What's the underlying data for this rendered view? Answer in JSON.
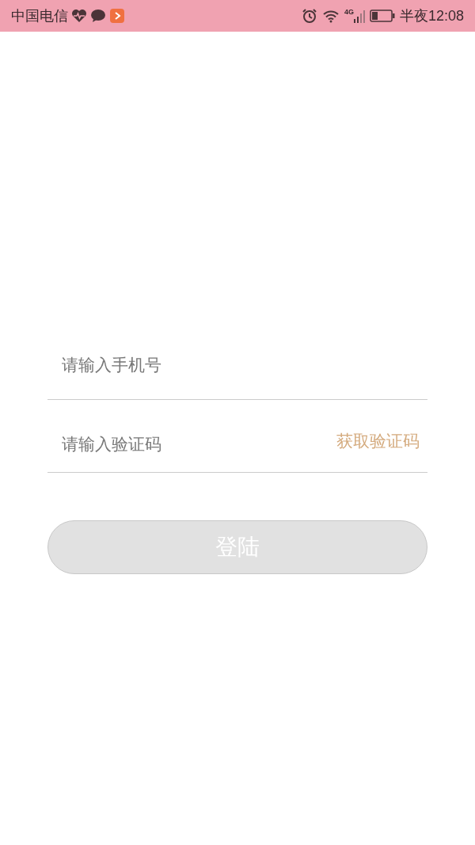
{
  "status_bar": {
    "carrier": "中国电信",
    "clock_prefix": "半夜",
    "time": "12:08",
    "network": "4G"
  },
  "phone_field": {
    "placeholder": "请输入手机号"
  },
  "code_field": {
    "placeholder": "请输入验证码"
  },
  "get_code_button": {
    "label": "获取验证码"
  },
  "login_button": {
    "label": "登陆",
    "disabled": true
  }
}
